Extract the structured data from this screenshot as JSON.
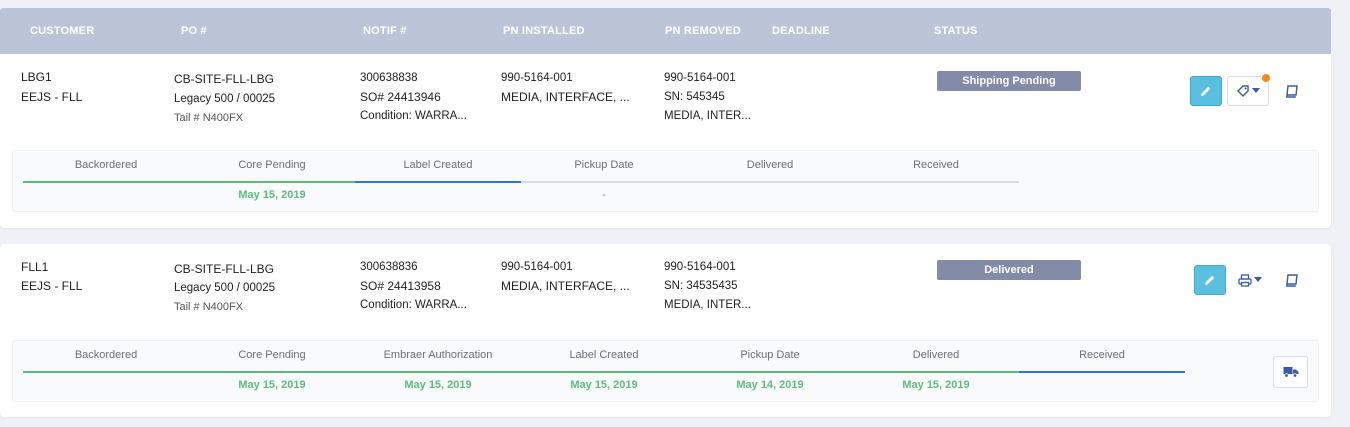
{
  "columns": [
    "CUSTOMER",
    "PO #",
    "NOTIF #",
    "PN INSTALLED",
    "PN REMOVED",
    "DEADLINE",
    "STATUS"
  ],
  "rows": [
    {
      "customer": [
        "LBG1",
        "EEJS - FLL"
      ],
      "po": [
        "CB-SITE-FLL-LBG",
        "Legacy 500 / 00025",
        "Tail # N400FX"
      ],
      "notif": [
        "300638838",
        "SO# 24413946",
        "Condition: WARRA..."
      ],
      "pn_installed": [
        "990-5164-001",
        "MEDIA, INTERFACE, ..."
      ],
      "pn_removed": [
        "990-5164-001",
        "SN: 545345",
        "MEDIA, INTER..."
      ],
      "status": "Shipping Pending",
      "steps": [
        {
          "label": "Backordered",
          "date": ""
        },
        {
          "label": "Core Pending",
          "date": "May 15, 2019"
        },
        {
          "label": "Label Created",
          "date": ""
        },
        {
          "label": "Pickup Date",
          "date": "-"
        },
        {
          "label": "Delivered",
          "date": ""
        },
        {
          "label": "Received",
          "date": ""
        }
      ]
    },
    {
      "customer": [
        "FLL1",
        "EEJS - FLL"
      ],
      "po": [
        "CB-SITE-FLL-LBG",
        "Legacy 500 / 00025",
        "Tail # N400FX"
      ],
      "notif": [
        "300638836",
        "SO# 24413958",
        "Condition: WARRA..."
      ],
      "pn_installed": [
        "990-5164-001",
        "MEDIA, INTERFACE, ..."
      ],
      "pn_removed": [
        "990-5164-001",
        "SN: 34535435",
        "MEDIA, INTER..."
      ],
      "status": "Delivered",
      "steps": [
        {
          "label": "Backordered",
          "date": ""
        },
        {
          "label": "Core Pending",
          "date": "May 15, 2019"
        },
        {
          "label": "Embraer Authorization",
          "date": "May 15, 2019"
        },
        {
          "label": "Label Created",
          "date": "May 15, 2019"
        },
        {
          "label": "Pickup Date",
          "date": "May 14, 2019"
        },
        {
          "label": "Delivered",
          "date": "May 15, 2019"
        },
        {
          "label": "Received",
          "date": ""
        }
      ]
    }
  ],
  "colors": {
    "status_badge": "#838ba8",
    "edit_button": "#5bbfe0",
    "progress_done": "#5cbd7a",
    "progress_active": "#2f75d4",
    "notification_dot": "#f08a1a",
    "header_bg": "#bcc5d7"
  },
  "icons": [
    "pencil-icon",
    "tag-icon",
    "printer-icon",
    "book-icon",
    "truck-icon",
    "caret-down-icon"
  ]
}
